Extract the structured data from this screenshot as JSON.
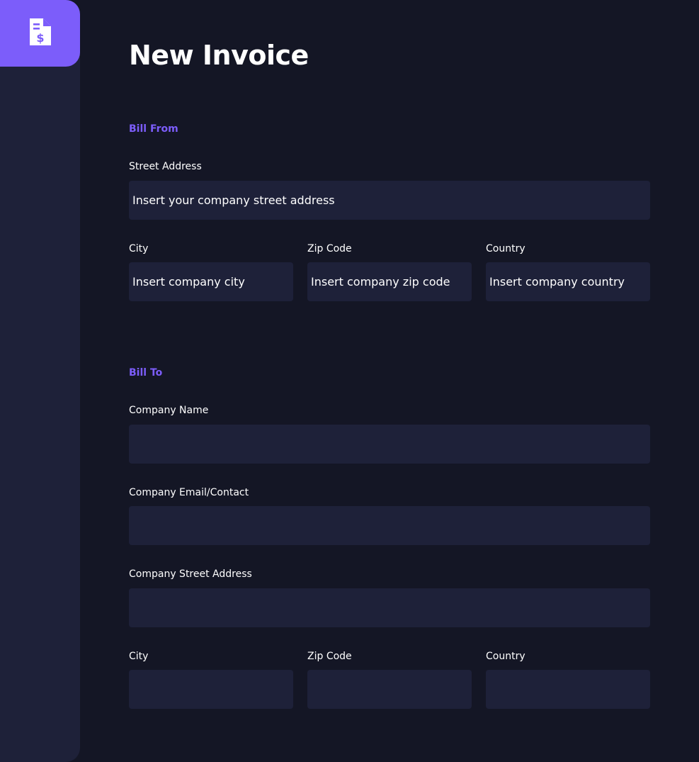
{
  "app": {
    "logo_icon": "invoice-dollar-icon",
    "accent_color": "#7c5dfa",
    "background_color": "#141625",
    "panel_color": "#1e2139"
  },
  "page": {
    "title": "New Invoice"
  },
  "bill_from": {
    "heading": "Bill From",
    "street": {
      "label": "Street Address",
      "value": "",
      "placeholder": "Insert your company street address"
    },
    "city": {
      "label": "City",
      "value": "",
      "placeholder": "Insert company city"
    },
    "zip": {
      "label": "Zip Code",
      "value": "",
      "placeholder": "Insert company zip code"
    },
    "country": {
      "label": "Country",
      "value": "",
      "placeholder": "Insert company country"
    }
  },
  "bill_to": {
    "heading": "Bill To",
    "company_name": {
      "label": "Company Name",
      "value": "",
      "placeholder": ""
    },
    "company_email": {
      "label": "Company Email/Contact",
      "value": "",
      "placeholder": ""
    },
    "company_street": {
      "label": "Company Street Address",
      "value": "",
      "placeholder": ""
    },
    "city": {
      "label": "City",
      "value": "",
      "placeholder": ""
    },
    "zip": {
      "label": "Zip Code",
      "value": "",
      "placeholder": ""
    },
    "country": {
      "label": "Country",
      "value": "",
      "placeholder": ""
    }
  }
}
